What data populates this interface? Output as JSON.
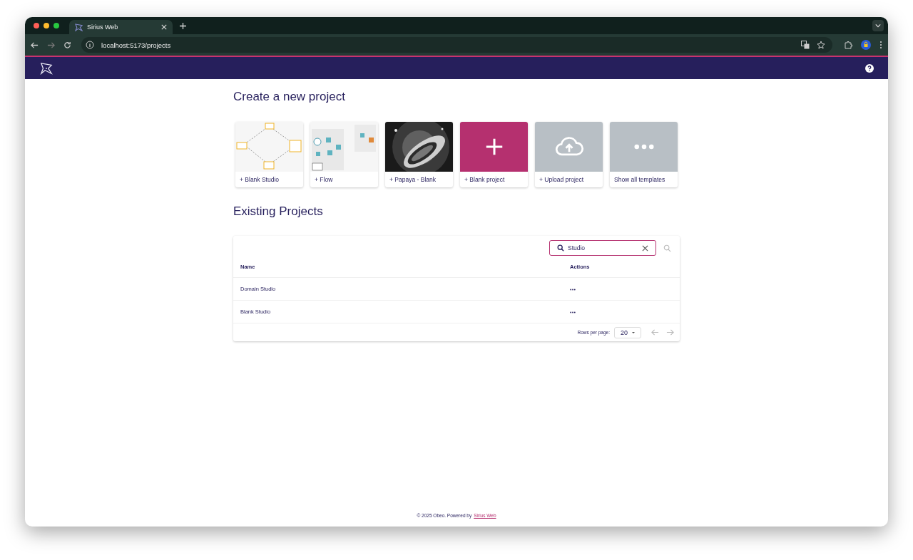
{
  "browser": {
    "tab_title": "Sirius Web",
    "url": "localhost:5173/projects"
  },
  "create": {
    "title": "Create a new project",
    "templates": [
      {
        "kind": "diagram",
        "label": "+ Blank Studio"
      },
      {
        "kind": "flow",
        "label": "+ Flow"
      },
      {
        "kind": "picture",
        "label": "+ Papaya - Blank"
      },
      {
        "kind": "blank",
        "label": "+ Blank project"
      },
      {
        "kind": "upload",
        "label": "+ Upload project"
      },
      {
        "kind": "more",
        "label": "Show all templates"
      }
    ]
  },
  "projects": {
    "title": "Existing Projects",
    "search": {
      "value": "Studio"
    },
    "columns": [
      "Name",
      "Actions"
    ],
    "rows": [
      {
        "name": "Domain Studio"
      },
      {
        "name": "Blank Studio"
      }
    ],
    "pagination": {
      "rows_per_page_label": "Rows per page:",
      "rows_per_page": "20"
    }
  },
  "footer": {
    "text": "© 2025 Obeo. Powered by",
    "link": "Sirius Web"
  }
}
